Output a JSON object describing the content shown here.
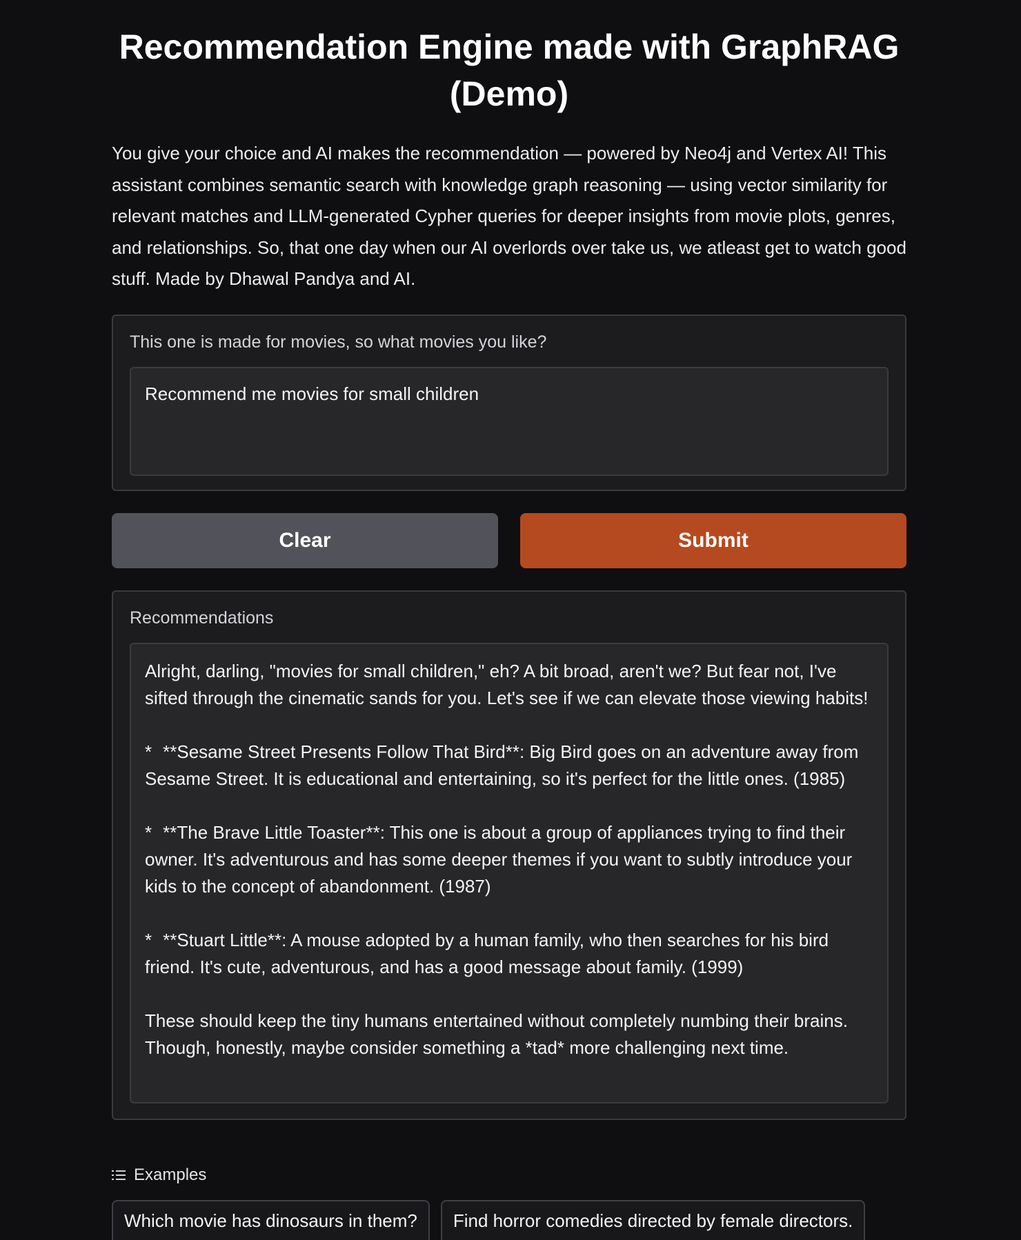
{
  "header": {
    "title": "Recommendation Engine made with GraphRAG (Demo)",
    "description": "You give your choice and AI makes the recommendation — powered by Neo4j and Vertex AI! This assistant combines semantic search with knowledge graph reasoning — using vector similarity for relevant matches and LLM-generated Cypher queries for deeper insights from movie plots, genres, and relationships. So, that one day when our AI overlords over take us, we atleast get to watch good stuff. Made by Dhawal Pandya and AI."
  },
  "input": {
    "label": "This one is made for movies, so what movies you like?",
    "value": "Recommend me movies for small children"
  },
  "buttons": {
    "clear": "Clear",
    "submit": "Submit"
  },
  "output": {
    "label": "Recommendations",
    "intro": "Alright, darling, \"movies for small children,\" eh? A bit broad, aren't we? But fear not, I've sifted through the cinematic sands for you. Let's see if we can elevate those viewing habits!",
    "items": [
      {
        "bullet": "*",
        "text": "**Sesame Street Presents Follow That Bird**: Big Bird goes on an adventure away from Sesame Street. It is educational and entertaining, so it's perfect for the little ones. (1985)"
      },
      {
        "bullet": "*",
        "text": "**The Brave Little Toaster**: This one is about a group of appliances trying to find their owner. It's adventurous and has some deeper themes if you want to subtly introduce your kids to the concept of abandonment. (1987)"
      },
      {
        "bullet": "*",
        "text": "**Stuart Little**: A mouse adopted by a human family, who then searches for his bird friend. It's cute, adventurous, and has a good message about family. (1999)"
      }
    ],
    "outro": "These should keep the tiny humans entertained without completely numbing their brains. Though, honestly, maybe consider something a *tad* more challenging next time."
  },
  "examples": {
    "label": "Examples",
    "icon": "list-icon",
    "items": [
      "Which movie has dinosaurs in them?",
      "Find horror comedies directed by female directors."
    ]
  },
  "colors": {
    "background": "#0f0f11",
    "panel": "#1c1c1f",
    "submit": "#b54a20",
    "clear": "#52525b"
  }
}
